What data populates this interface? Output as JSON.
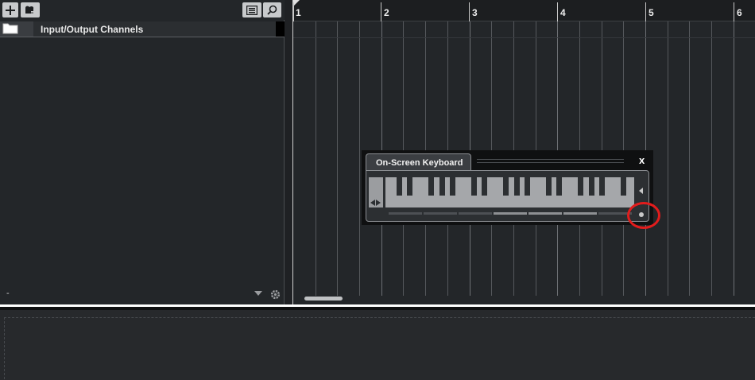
{
  "toolbar": {
    "add_track_icon": "plus-icon",
    "add_folder_icon": "add-folder-icon",
    "list_view_icon": "list-icon",
    "search_icon": "search-icon"
  },
  "tracks": [
    {
      "name": "Input/Output Channels",
      "icon": "folder-icon"
    }
  ],
  "left_footer": {
    "text": "-",
    "dropdown_icon": "chevron-down-icon",
    "settings_icon": "gear-icon"
  },
  "ruler": {
    "bars": [
      "1",
      "2",
      "3",
      "4",
      "5",
      "6"
    ]
  },
  "on_screen_keyboard": {
    "title": "On-Screen Keyboard",
    "close_label": "x"
  },
  "colors": {
    "background": "#232629",
    "annotation": "#e21c1c",
    "keys": "#a5a7aa"
  }
}
